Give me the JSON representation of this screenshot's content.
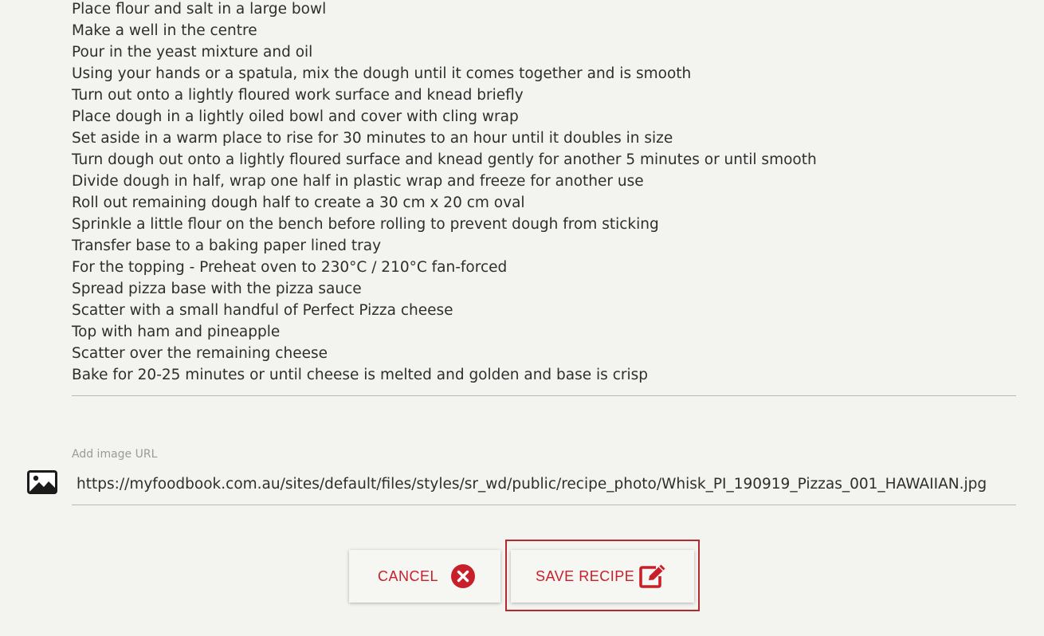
{
  "method": {
    "steps": [
      "Place flour and salt in a large bowl",
      "Make a well in the centre",
      "Pour in the yeast mixture and oil",
      "Using your hands or a spatula, mix the dough until it comes together and is smooth",
      "Turn out onto a lightly floured work surface and knead briefly",
      "Place dough in a lightly oiled bowl and cover with cling wrap",
      "Set aside in a warm place to rise for 30 minutes to an hour until it doubles in size",
      "Turn dough out onto a lightly floured surface and knead gently for another 5 minutes or until smooth",
      "Divide dough in half, wrap one half in plastic wrap and freeze for another use",
      "Roll out remaining dough half to create a 30 cm x 20 cm oval",
      "Sprinkle a little flour on the bench before rolling to prevent dough from sticking",
      "Transfer base to a baking paper lined tray",
      "For the topping - Preheat oven to 230°C / 210°C fan-forced",
      "Spread pizza base with the pizza sauce",
      "Scatter with a small handful of Perfect Pizza cheese",
      "Top with ham and pineapple",
      "Scatter over the remaining cheese",
      "Bake for 20-25 minutes or until cheese is melted and golden and base is crisp"
    ]
  },
  "image_field": {
    "label": "Add image URL",
    "value": "https://myfoodbook.com.au/sites/default/files/styles/sr_wd/public/recipe_photo/Whisk_PI_190919_Pizzas_001_HAWAIIAN.jpg",
    "icon": "image-icon"
  },
  "actions": {
    "cancel_label": "CANCEL",
    "cancel_icon": "close-circle-icon",
    "save_label": "SAVE RECIPE",
    "save_icon": "edit-icon"
  },
  "colors": {
    "accent": "#c8202b",
    "background": "#f3f3ef",
    "focus_outline": "#b22a2f"
  }
}
